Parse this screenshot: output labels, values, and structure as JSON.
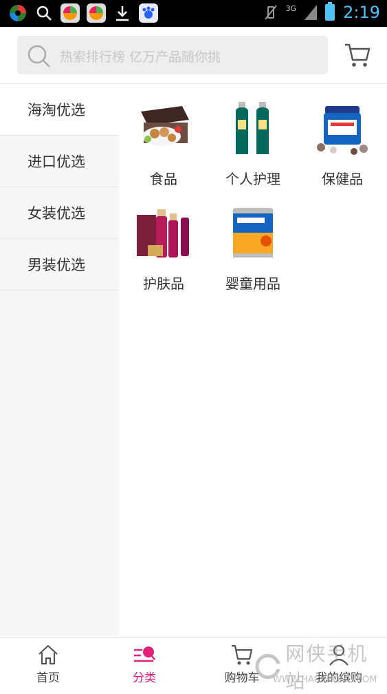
{
  "status_bar": {
    "network": "3G",
    "time": "2:19"
  },
  "search": {
    "placeholder": "热索排行榜 亿万产品随你挑"
  },
  "sidebar": {
    "items": [
      {
        "label": "海淘优选",
        "active": true
      },
      {
        "label": "进口优选",
        "active": false
      },
      {
        "label": "女装优选",
        "active": false
      },
      {
        "label": "男装优选",
        "active": false
      }
    ]
  },
  "categories": [
    {
      "label": "食品",
      "icon": "food-gift-box"
    },
    {
      "label": "个人护理",
      "icon": "shampoo-bottles"
    },
    {
      "label": "保健品",
      "icon": "health-supplement-jar"
    },
    {
      "label": "护肤品",
      "icon": "skincare-set"
    },
    {
      "label": "婴童用品",
      "icon": "infant-formula-can"
    }
  ],
  "bottom_nav": {
    "items": [
      {
        "label": "首页",
        "icon": "home-icon",
        "active": false
      },
      {
        "label": "分类",
        "icon": "category-icon",
        "active": true
      },
      {
        "label": "购物车",
        "icon": "cart-icon",
        "active": false
      },
      {
        "label": "我的缤购",
        "icon": "profile-icon",
        "active": false
      }
    ]
  },
  "watermark": {
    "brand": "网侠手机站",
    "url": "WWW.HACKHOME.COM"
  },
  "colors": {
    "accent": "#e0217a",
    "status_time": "#4fc3f7"
  }
}
